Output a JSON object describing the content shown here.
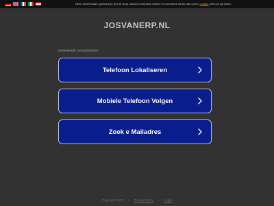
{
  "topbar": {
    "flags": [
      "german-flag-icon",
      "uk-flag-icon",
      "french-flag-icon",
      "italian-flag-icon",
      "dutch-flag-icon"
    ],
    "notice_before": "Deze domeinnaam (josvanerp.nl) is te koop. Wacht u interesse hebben in overname email, dan kunt u",
    "notice_link": "contact",
    "notice_after": "met ons opnemen."
  },
  "header": {
    "domain": "JOSVANERP.NL"
  },
  "main": {
    "related_label": "Gerelateerde zoekopdrachten",
    "links": [
      {
        "label": "Telefoon Lokaliseren"
      },
      {
        "label": "Mobiele Telefoon Volgen"
      },
      {
        "label": "Zoek e Mailadres"
      }
    ]
  },
  "footer": {
    "copyright": "Copyright 2023",
    "privacy": "Privacy Policy",
    "legal": "Legal"
  },
  "colors": {
    "background": "#323232",
    "topbar": "#111111",
    "button": "#091d8c",
    "button_border": "#b9bee6",
    "link_accent": "#e0a020"
  }
}
